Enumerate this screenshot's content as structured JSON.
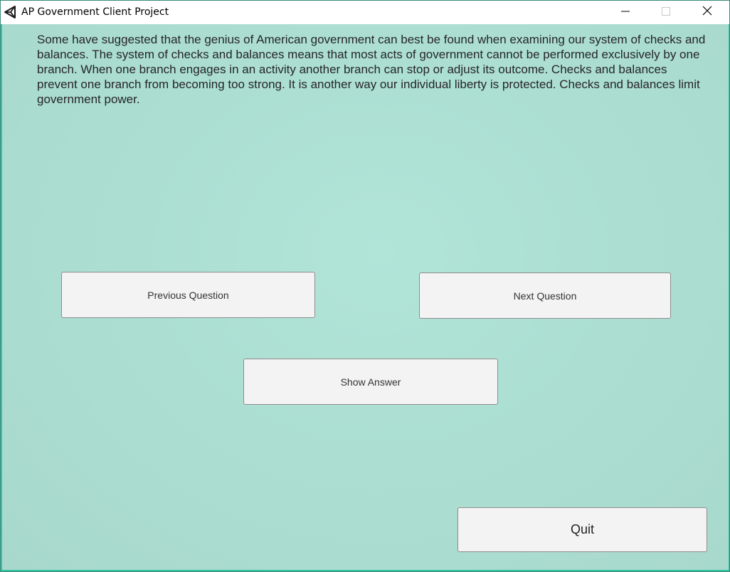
{
  "window": {
    "title": "AP Government Client Project",
    "icon": "unity-logo-icon",
    "controls": {
      "minimize_icon": "minimize-icon",
      "maximize_icon": "maximize-icon",
      "close_icon": "close-icon"
    }
  },
  "main": {
    "question_text": "Some have suggested that the genius of American government can best be found when examining our system of checks and balances. The system of checks and balances means that most acts of government cannot be performed exclusively by one branch. When one branch engages in an activity another branch can stop or adjust its outcome. Checks and balances prevent one branch from becoming too strong. It is another way our individual liberty is protected. Checks and balances limit government power.",
    "buttons": {
      "previous_label": "Previous Question",
      "next_label": "Next Question",
      "show_answer_label": "Show Answer",
      "quit_label": "Quit"
    }
  },
  "colors": {
    "background": "#acdfd2",
    "window_border": "#33c4a4",
    "button_fill": "#f3f3f3"
  }
}
